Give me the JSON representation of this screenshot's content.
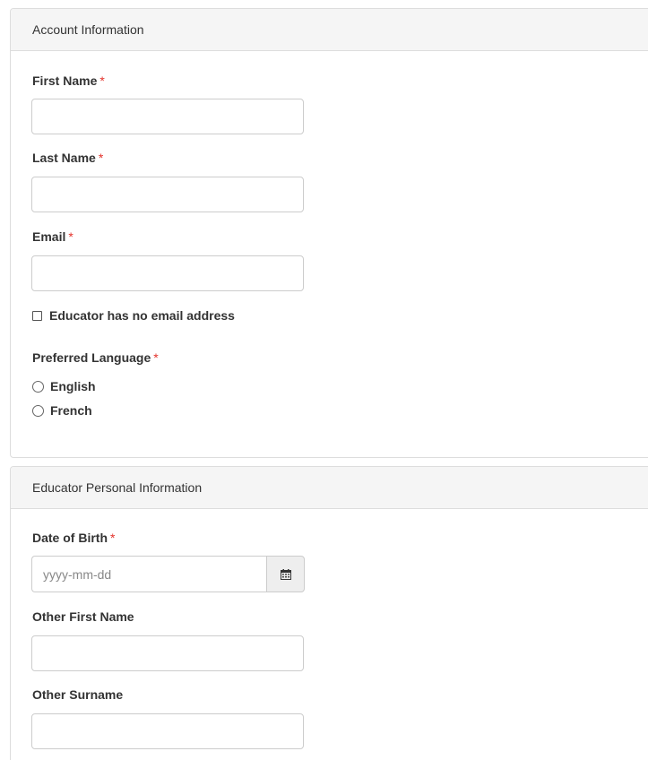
{
  "account_panel": {
    "heading": "Account Information",
    "first_name": {
      "label": "First Name",
      "required_mark": "*",
      "value": ""
    },
    "last_name": {
      "label": "Last Name",
      "required_mark": "*",
      "value": ""
    },
    "email": {
      "label": "Email",
      "required_mark": "*",
      "value": ""
    },
    "no_email_checkbox": {
      "label": "Educator has no email address",
      "checked": false
    },
    "preferred_language": {
      "label": "Preferred Language",
      "required_mark": "*",
      "options": [
        "English",
        "French"
      ],
      "selected": null
    }
  },
  "personal_panel": {
    "heading": "Educator Personal Information",
    "date_of_birth": {
      "label": "Date of Birth",
      "required_mark": "*",
      "placeholder": "yyyy-mm-dd",
      "icon": "calendar-icon"
    },
    "other_first_name": {
      "label": "Other First Name",
      "value": ""
    },
    "other_surname": {
      "label": "Other Surname",
      "value": ""
    }
  },
  "colors": {
    "required": "#e4322b",
    "panel_heading_bg": "#f5f5f5",
    "border": "#cccccc",
    "addon_bg": "#eeeeee"
  }
}
